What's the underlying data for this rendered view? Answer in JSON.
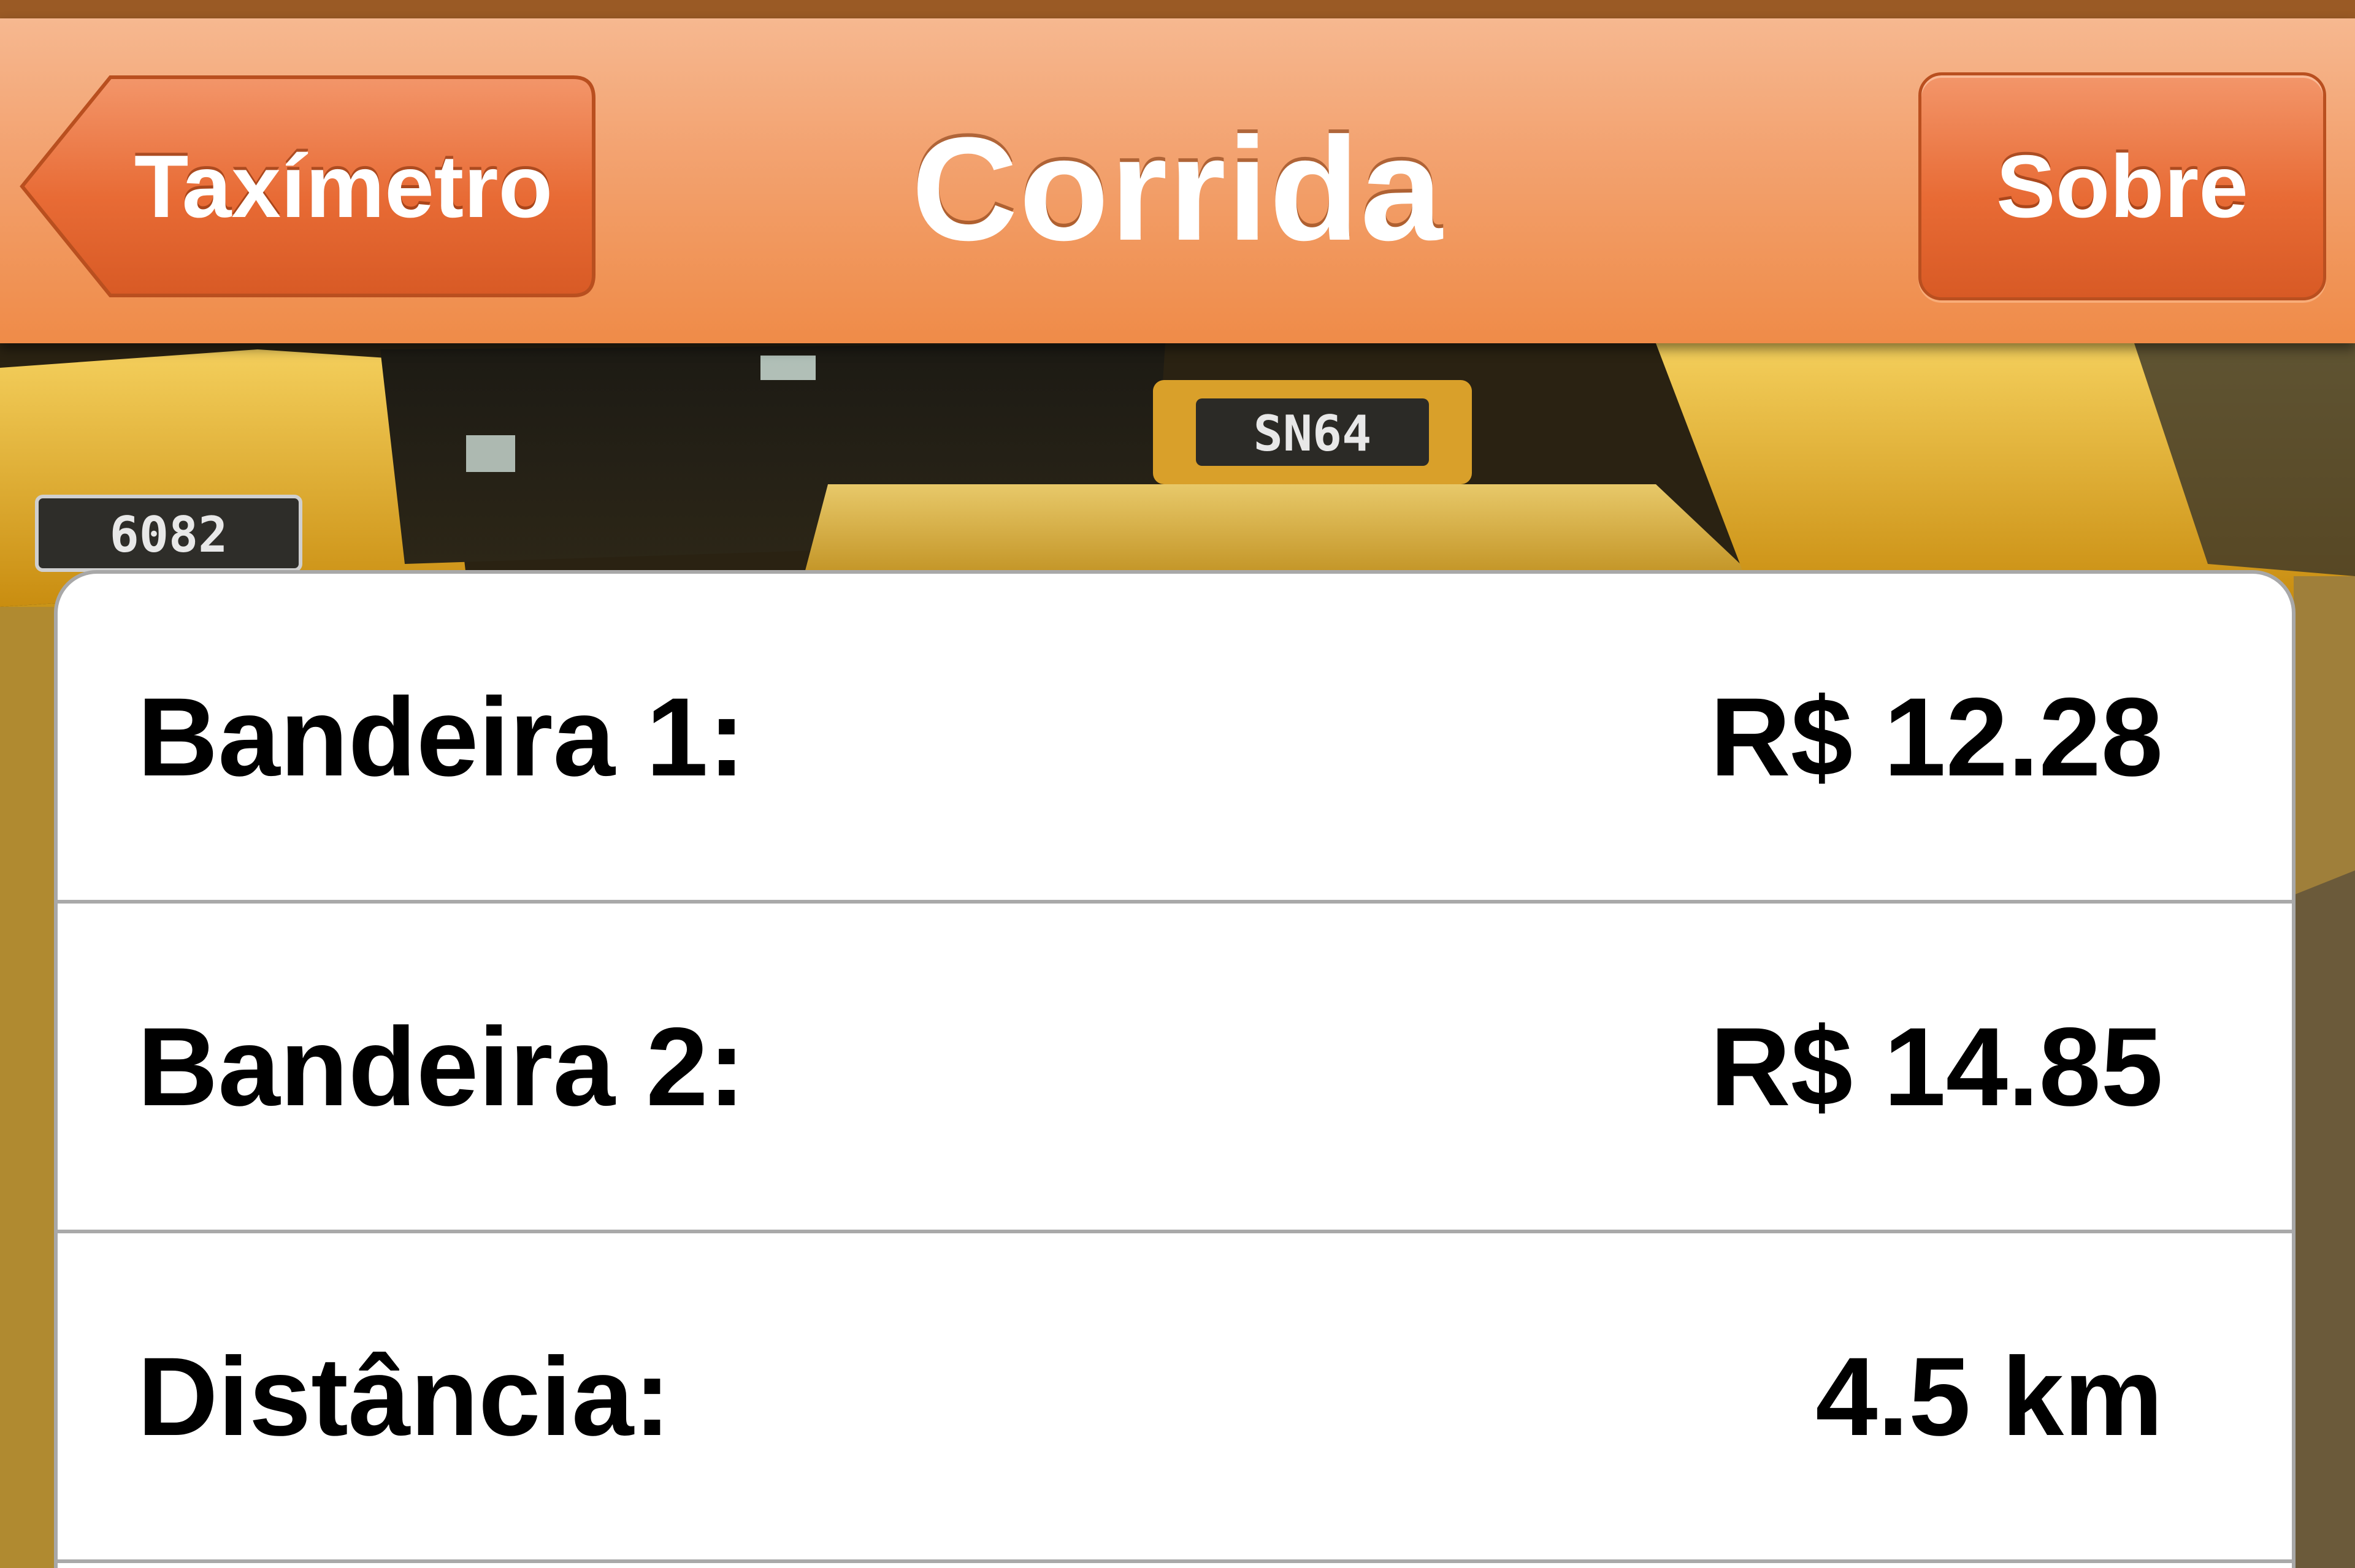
{
  "navbar": {
    "title": "Corrida",
    "back_label": "Taxímetro",
    "about_label": "Sobre"
  },
  "background": {
    "description_icon": "taxi-photo",
    "plates": [
      "6082",
      "SN64"
    ]
  },
  "ride": {
    "rows": [
      {
        "label": "Bandeira 1:",
        "value": "R$ 12.28"
      },
      {
        "label": "Bandeira 2:",
        "value": "R$ 14.85"
      },
      {
        "label": "Distância:",
        "value": "4.5 km"
      }
    ]
  },
  "colors": {
    "navbar_accent": "#ef8b48",
    "button_accent": "#e86b35",
    "taxi_yellow": "#e9b01e"
  }
}
